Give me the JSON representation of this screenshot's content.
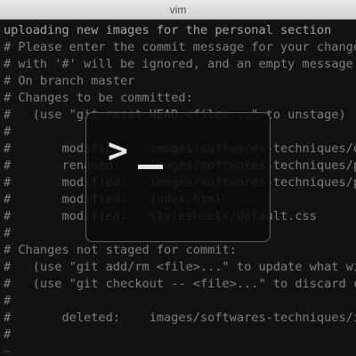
{
  "window": {
    "title": "vim"
  },
  "buffer": {
    "lines": [
      "uploading new images for the personal section",
      "# Please enter the commit message for your changes. Lines starting",
      "# with '#' will be ignored, and an empty message aborts the commit.",
      "# On branch master",
      "# Changes to be committed:",
      "#   (use \"git reset HEAD <file>...\" to unstage)",
      "#",
      "#       modified:   images/softwares-techniques/eve",
      "#       renamed:    images/softwares-techniques/pomo",
      "#       modified:   images/softwares-techniques/pomo",
      "#       modified:   index.html",
      "#       modified:   stylesheets/default.css",
      "#",
      "# Changes not staged for commit:",
      "#   (use \"git add/rm <file>...\" to update what will",
      "#   (use \"git checkout -- <file>...\" to discard chan",
      "#",
      "#       deleted:    images/softwares-techniques/ital",
      "#",
      "~"
    ]
  },
  "overlay": {
    "icon": "terminal-icon",
    "prompt_symbol": ">"
  }
}
